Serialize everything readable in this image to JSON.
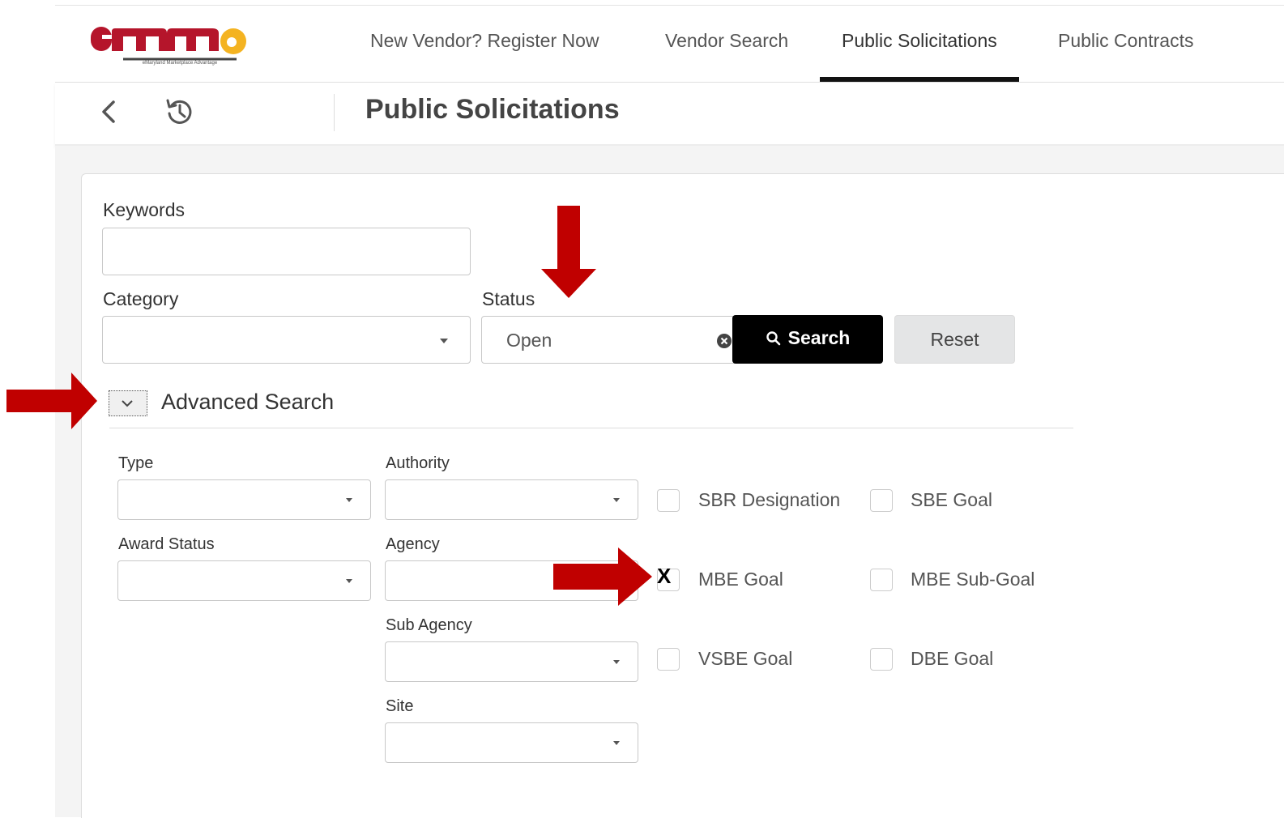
{
  "nav": {
    "logo_text": "emma",
    "logo_tagline": "eMaryland Marketplace Advantage",
    "items": [
      {
        "label": "New Vendor? Register Now"
      },
      {
        "label": "Vendor Search"
      },
      {
        "label": "Public Solicitations",
        "active": true
      },
      {
        "label": "Public Contracts"
      }
    ]
  },
  "titlebar": {
    "title": "Public Solicitations",
    "back_icon": "chevron-left-icon",
    "history_icon": "history-icon"
  },
  "search": {
    "keywords_label": "Keywords",
    "keywords_value": "",
    "category_label": "Category",
    "category_value": "",
    "status_label": "Status",
    "status_value": "Open",
    "search_button": "Search",
    "reset_button": "Reset"
  },
  "advanced": {
    "title": "Advanced Search",
    "expanded": true,
    "fields": {
      "type_label": "Type",
      "authority_label": "Authority",
      "award_status_label": "Award Status",
      "agency_label": "Agency",
      "sub_agency_label": "Sub Agency",
      "site_label": "Site"
    },
    "checkboxes": [
      {
        "label": "SBR Designation",
        "checked": false
      },
      {
        "label": "SBE Goal",
        "checked": false
      },
      {
        "label": "MBE Goal",
        "checked": false
      },
      {
        "label": "MBE Sub-Goal",
        "checked": false
      },
      {
        "label": "VSBE Goal",
        "checked": false
      },
      {
        "label": "DBE Goal",
        "checked": false
      }
    ]
  },
  "annotations": {
    "mark": "X",
    "arrow_color": "#c00000"
  },
  "colors": {
    "logo_red": "#b5152b",
    "logo_gold": "#f4b321",
    "search_button_bg": "#000000",
    "reset_button_bg": "#e4e5e6",
    "active_tab_underline": "#111111"
  }
}
